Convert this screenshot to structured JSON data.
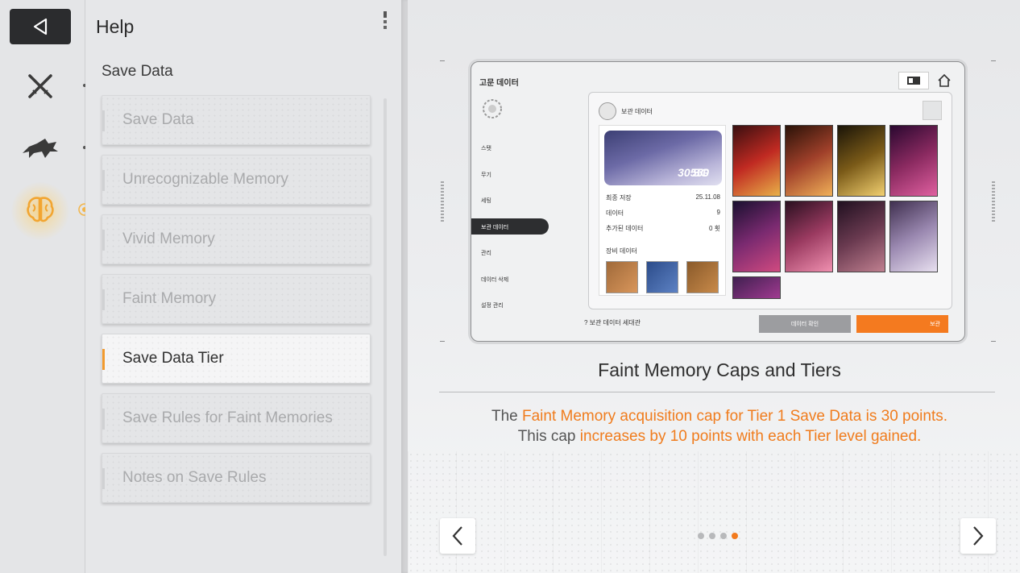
{
  "rail": {
    "back_icon": "back-triangle-icon",
    "items": [
      {
        "icon": "crossed-swords-icon"
      },
      {
        "icon": "wolf-icon"
      },
      {
        "icon": "brain-icon",
        "active": true
      }
    ],
    "accent_color": "#f2a531"
  },
  "help": {
    "title": "Help",
    "section": "Save Data",
    "items": [
      {
        "label": "Save Data"
      },
      {
        "label": "Unrecognizable Memory"
      },
      {
        "label": "Vivid Memory"
      },
      {
        "label": "Faint Memory"
      },
      {
        "label": "Save Data Tier",
        "active": true
      },
      {
        "label": "Save Rules for Faint Memories"
      },
      {
        "label": "Notes on Save Rules"
      }
    ]
  },
  "preview": {
    "window_title": "고문 데이터",
    "menu": [
      "스탯",
      "무기",
      "세팅",
      "보관 데이터",
      "관리",
      "데이터 삭제",
      "설정 관리"
    ],
    "selected_menu": "보관 데이터",
    "panel_title": "보관 데이터",
    "banner_value": "30550",
    "banner_unit": "SG",
    "rows": [
      {
        "label": "최종 저장",
        "value": "25.11.08"
      },
      {
        "label": "데이터",
        "value": "9"
      },
      {
        "label": "추가된 데이터",
        "value": "0 횟"
      }
    ],
    "weapons_label": "장비 데이터",
    "footer_text": "보관 데이터 세대관",
    "gray_button": "데이터 확인",
    "orange_button": "보관"
  },
  "caption": {
    "title": "Faint Memory Caps and Tiers",
    "line1_pre": "The ",
    "line1_hl": "Faint Memory acquisition cap for Tier 1 Save Data is 30 points",
    "line1_post": ".",
    "line2_pre": "This cap ",
    "line2_hl": "increases by 10 points with each Tier level gained",
    "line2_post": ".",
    "highlight_color": "#f07c1d"
  },
  "pager": {
    "total": 4,
    "current": 4
  },
  "nav": {
    "prev_icon": "chevron-left-icon",
    "next_icon": "chevron-right-icon"
  }
}
